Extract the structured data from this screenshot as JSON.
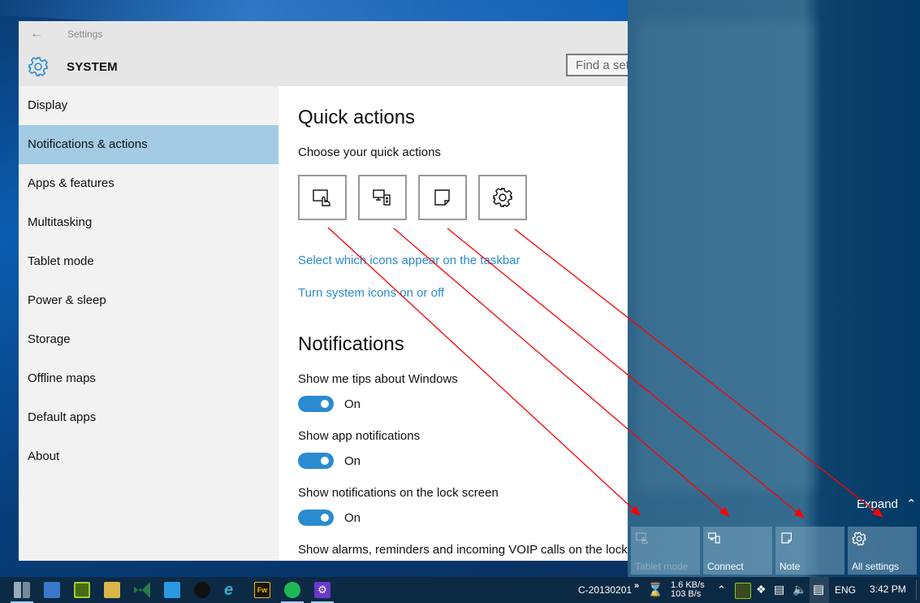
{
  "window": {
    "title": "Settings",
    "section": "SYSTEM",
    "search_placeholder": "Find a setting"
  },
  "sidebar": {
    "items": [
      {
        "label": "Display"
      },
      {
        "label": "Notifications & actions",
        "selected": true
      },
      {
        "label": "Apps & features"
      },
      {
        "label": "Multitasking"
      },
      {
        "label": "Tablet mode"
      },
      {
        "label": "Power & sleep"
      },
      {
        "label": "Storage"
      },
      {
        "label": "Offline maps"
      },
      {
        "label": "Default apps"
      },
      {
        "label": "About"
      }
    ]
  },
  "content": {
    "quick_actions_heading": "Quick actions",
    "choose_label": "Choose your quick actions",
    "quick_action_tiles": [
      {
        "icon": "tablet-mode-icon",
        "name": "Tablet mode"
      },
      {
        "icon": "connect-icon",
        "name": "Connect"
      },
      {
        "icon": "note-icon",
        "name": "Note"
      },
      {
        "icon": "settings-gear-icon",
        "name": "All settings"
      }
    ],
    "link_taskbar_icons": "Select which icons appear on the taskbar",
    "link_system_icons": "Turn system icons on or off",
    "notifications_heading": "Notifications",
    "settings": [
      {
        "label": "Show me tips about Windows",
        "state": "On",
        "on": true
      },
      {
        "label": "Show app notifications",
        "state": "On",
        "on": true
      },
      {
        "label": "Show notifications on the lock screen",
        "state": "On",
        "on": true
      },
      {
        "label": "Show alarms, reminders and incoming VOIP calls on the lock"
      }
    ]
  },
  "action_center": {
    "expand_label": "Expand",
    "tiles": [
      {
        "label": "Tablet mode",
        "disabled": true
      },
      {
        "label": "Connect"
      },
      {
        "label": "Note"
      },
      {
        "label": "All settings"
      }
    ]
  },
  "taskbar": {
    "pinned_apps": [
      "server-manager",
      "remote-desktop",
      "vmware-vsphere",
      "snipping-tool",
      "visual-studio",
      "baidu-app",
      "obs",
      "internet-explorer",
      "fireworks",
      "spotify",
      "settings-app"
    ],
    "computer_name": "C-20130201",
    "net_up": "1.6 KB/s",
    "net_down": "103 B/s",
    "language": "ENG",
    "time": "3:42 PM"
  },
  "colors": {
    "accent": "#2a8bd0",
    "selected_nav": "#a3cbe4",
    "annotation_arrow": "#ff0000"
  }
}
